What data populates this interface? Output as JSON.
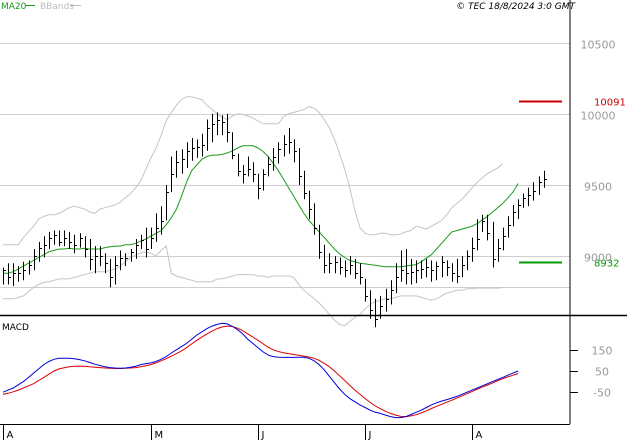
{
  "header": {
    "legend": [
      {
        "label": "MA20",
        "color": "#1a9a1a"
      },
      {
        "label": "BBands",
        "color": "#bbbbbb"
      }
    ],
    "copyright": "© TEC 18/8/2024 3:0 GMT"
  },
  "chart_data": [
    {
      "type": "line",
      "panel": "price",
      "ylim": [
        8600,
        10800
      ],
      "y_ticks": [
        10500,
        10000,
        9500,
        9000
      ],
      "y_tick_labels": [
        "10500",
        "10000",
        "9500",
        "9000"
      ],
      "x_labels": [
        "A",
        "M",
        "J",
        "J",
        "A"
      ],
      "x_label_bar_index": [
        0,
        29,
        50,
        71,
        92
      ],
      "grid": true,
      "markers": [
        {
          "label": "10091",
          "value": 10091,
          "color": "#cc0000"
        },
        {
          "label": "8932",
          "value": 8960,
          "color": "#009900"
        }
      ],
      "series": [
        {
          "name": "MA20",
          "color": "#1a9a1a",
          "values": [
            8880,
            8880,
            8890,
            8910,
            8930,
            8950,
            8970,
            8990,
            9010,
            9030,
            9040,
            9050,
            9050,
            9055,
            9050,
            9050,
            9055,
            9050,
            9050,
            9050,
            9060,
            9065,
            9070,
            9070,
            9080,
            9080,
            9090,
            9105,
            9120,
            9140,
            9160,
            9180,
            9220,
            9270,
            9330,
            9420,
            9520,
            9600,
            9640,
            9680,
            9700,
            9710,
            9710,
            9715,
            9725,
            9740,
            9760,
            9775,
            9775,
            9775,
            9760,
            9735,
            9700,
            9650,
            9600,
            9540,
            9480,
            9420,
            9360,
            9300,
            9250,
            9210,
            9170,
            9130,
            9090,
            9050,
            9015,
            8990,
            8970,
            8960,
            8950,
            8945,
            8940,
            8935,
            8930,
            8925,
            8925,
            8925,
            8925,
            8930,
            8935,
            8940,
            8960,
            8985,
            9010,
            9050,
            9090,
            9130,
            9170,
            9180,
            9190,
            9200,
            9210,
            9230,
            9255,
            9280,
            9310,
            9340,
            9370,
            9410,
            9450,
            9510
          ]
        },
        {
          "name": "BBands",
          "color": "#c4c4c4",
          "values": [
            9080,
            9080,
            9080,
            9080,
            9130,
            9170,
            9210,
            9260,
            9280,
            9290,
            9290,
            9300,
            9320,
            9340,
            9350,
            9340,
            9330,
            9310,
            9300,
            9330,
            9340,
            9350,
            9360,
            9380,
            9410,
            9440,
            9480,
            9530,
            9610,
            9690,
            9760,
            9850,
            9950,
            10010,
            10060,
            10100,
            10120,
            10120,
            10110,
            10100,
            10060,
            10030,
            10000,
            9975,
            9960,
            9985,
            10000,
            9995,
            9985,
            9970,
            9950,
            9930,
            9930,
            9930,
            9930,
            9980,
            10000,
            10010,
            10020,
            10030,
            10050,
            10040,
            10010,
            9960,
            9900,
            9820,
            9720,
            9610,
            9480,
            9320,
            9200,
            9160,
            9150,
            9150,
            9160,
            9160,
            9150,
            9150,
            9155,
            9170,
            9180,
            9210,
            9200,
            9190,
            9210,
            9230,
            9250,
            9290,
            9340,
            9370,
            9400,
            9440,
            9480,
            9520,
            9550,
            9580,
            9600,
            9620,
            9650
          ]
        },
        {
          "name": "BBands",
          "color": "#c4c4c4",
          "values": [
            8700,
            8700,
            8700,
            8710,
            8720,
            8750,
            8780,
            8800,
            8815,
            8820,
            8830,
            8840,
            8840,
            8840,
            8850,
            8860,
            8870,
            8880,
            8890,
            8890,
            8890,
            8900,
            8910,
            8930,
            8960,
            8990,
            9010,
            9020,
            9030,
            9020,
            9000,
            9040,
            9070,
            8880,
            8860,
            8850,
            8840,
            8830,
            8820,
            8820,
            8820,
            8820,
            8840,
            8840,
            8850,
            8860,
            8870,
            8870,
            8870,
            8870,
            8860,
            8860,
            8850,
            8860,
            8860,
            8860,
            8860,
            8850,
            8800,
            8760,
            8730,
            8700,
            8670,
            8630,
            8590,
            8550,
            8520,
            8510,
            8540,
            8570,
            8590,
            8630,
            8660,
            8680,
            8690,
            8700,
            8700,
            8710,
            8720,
            8720,
            8720,
            8720,
            8710,
            8700,
            8690,
            8700,
            8720,
            8740,
            8750,
            8760,
            8760,
            8770,
            8770,
            8775,
            8775,
            8775,
            8775,
            8775,
            8780
          ]
        }
      ],
      "bars": [
        {
          "h": 8920,
          "l": 8800,
          "c": 8900
        },
        {
          "h": 8950,
          "l": 8800,
          "c": 8850
        },
        {
          "h": 8950,
          "l": 8790,
          "c": 8880
        },
        {
          "h": 8930,
          "l": 8820,
          "c": 8880
        },
        {
          "h": 8960,
          "l": 8830,
          "c": 8900
        },
        {
          "h": 8970,
          "l": 8870,
          "c": 8940
        },
        {
          "h": 9050,
          "l": 8900,
          "c": 9000
        },
        {
          "h": 9100,
          "l": 8960,
          "c": 9060
        },
        {
          "h": 9140,
          "l": 8990,
          "c": 9080
        },
        {
          "h": 9170,
          "l": 9050,
          "c": 9130
        },
        {
          "h": 9180,
          "l": 9080,
          "c": 9150
        },
        {
          "h": 9180,
          "l": 9070,
          "c": 9100
        },
        {
          "h": 9180,
          "l": 9070,
          "c": 9130
        },
        {
          "h": 9170,
          "l": 9050,
          "c": 9100
        },
        {
          "h": 9150,
          "l": 9020,
          "c": 9080
        },
        {
          "h": 9160,
          "l": 9060,
          "c": 9130
        },
        {
          "h": 9140,
          "l": 8990,
          "c": 9050
        },
        {
          "h": 9120,
          "l": 8900,
          "c": 8980
        },
        {
          "h": 9070,
          "l": 8880,
          "c": 9000
        },
        {
          "h": 9070,
          "l": 8930,
          "c": 9000
        },
        {
          "h": 9020,
          "l": 8880,
          "c": 8950
        },
        {
          "h": 8980,
          "l": 8780,
          "c": 8850
        },
        {
          "h": 9000,
          "l": 8800,
          "c": 8940
        },
        {
          "h": 9040,
          "l": 8900,
          "c": 8990
        },
        {
          "h": 9020,
          "l": 8930,
          "c": 8990
        },
        {
          "h": 9050,
          "l": 8960,
          "c": 9030
        },
        {
          "h": 9120,
          "l": 8980,
          "c": 9080
        },
        {
          "h": 9150,
          "l": 9050,
          "c": 9110
        },
        {
          "h": 9200,
          "l": 8990,
          "c": 9050
        },
        {
          "h": 9200,
          "l": 9050,
          "c": 9130
        },
        {
          "h": 9300,
          "l": 9100,
          "c": 9200
        },
        {
          "h": 9350,
          "l": 9150,
          "c": 9250
        },
        {
          "h": 9500,
          "l": 9250,
          "c": 9450
        },
        {
          "h": 9700,
          "l": 9450,
          "c": 9580
        },
        {
          "h": 9740,
          "l": 9550,
          "c": 9660
        },
        {
          "h": 9750,
          "l": 9580,
          "c": 9680
        },
        {
          "h": 9800,
          "l": 9620,
          "c": 9740
        },
        {
          "h": 9830,
          "l": 9670,
          "c": 9760
        },
        {
          "h": 9820,
          "l": 9690,
          "c": 9770
        },
        {
          "h": 9860,
          "l": 9700,
          "c": 9780
        },
        {
          "h": 9960,
          "l": 9740,
          "c": 9900
        },
        {
          "h": 10000,
          "l": 9800,
          "c": 9930
        },
        {
          "h": 10010,
          "l": 9850,
          "c": 9960
        },
        {
          "h": 9990,
          "l": 9850,
          "c": 9940
        },
        {
          "h": 10000,
          "l": 9800,
          "c": 9870
        },
        {
          "h": 9870,
          "l": 9680,
          "c": 9710
        },
        {
          "h": 9720,
          "l": 9560,
          "c": 9600
        },
        {
          "h": 9640,
          "l": 9510,
          "c": 9580
        },
        {
          "h": 9700,
          "l": 9560,
          "c": 9610
        },
        {
          "h": 9660,
          "l": 9520,
          "c": 9580
        },
        {
          "h": 9580,
          "l": 9400,
          "c": 9480
        },
        {
          "h": 9610,
          "l": 9460,
          "c": 9580
        },
        {
          "h": 9700,
          "l": 9560,
          "c": 9650
        },
        {
          "h": 9760,
          "l": 9600,
          "c": 9700
        },
        {
          "h": 9800,
          "l": 9650,
          "c": 9750
        },
        {
          "h": 9850,
          "l": 9700,
          "c": 9790
        },
        {
          "h": 9900,
          "l": 9720,
          "c": 9800
        },
        {
          "h": 9820,
          "l": 9660,
          "c": 9740
        },
        {
          "h": 9760,
          "l": 9500,
          "c": 9560
        },
        {
          "h": 9600,
          "l": 9400,
          "c": 9440
        },
        {
          "h": 9460,
          "l": 9260,
          "c": 9330
        },
        {
          "h": 9370,
          "l": 9150,
          "c": 9200
        },
        {
          "h": 9220,
          "l": 8980,
          "c": 9030
        },
        {
          "h": 9080,
          "l": 8880,
          "c": 8940
        },
        {
          "h": 9020,
          "l": 8880,
          "c": 8950
        },
        {
          "h": 9000,
          "l": 8880,
          "c": 8960
        },
        {
          "h": 8990,
          "l": 8870,
          "c": 8920
        },
        {
          "h": 8970,
          "l": 8850,
          "c": 8900
        },
        {
          "h": 9000,
          "l": 8870,
          "c": 8940
        },
        {
          "h": 8980,
          "l": 8840,
          "c": 8880
        },
        {
          "h": 8950,
          "l": 8800,
          "c": 8850
        },
        {
          "h": 8840,
          "l": 8680,
          "c": 8720
        },
        {
          "h": 8760,
          "l": 8560,
          "c": 8620
        },
        {
          "h": 8700,
          "l": 8500,
          "c": 8560
        },
        {
          "h": 8720,
          "l": 8560,
          "c": 8650
        },
        {
          "h": 8770,
          "l": 8610,
          "c": 8700
        },
        {
          "h": 8830,
          "l": 8660,
          "c": 8760
        },
        {
          "h": 8950,
          "l": 8740,
          "c": 8850
        },
        {
          "h": 9040,
          "l": 8820,
          "c": 8900
        },
        {
          "h": 9050,
          "l": 8800,
          "c": 8880
        },
        {
          "h": 8980,
          "l": 8800,
          "c": 8890
        },
        {
          "h": 8970,
          "l": 8810,
          "c": 8900
        },
        {
          "h": 8970,
          "l": 8840,
          "c": 8910
        },
        {
          "h": 8980,
          "l": 8850,
          "c": 8920
        },
        {
          "h": 8970,
          "l": 8820,
          "c": 8900
        },
        {
          "h": 8960,
          "l": 8830,
          "c": 8930
        },
        {
          "h": 9000,
          "l": 8850,
          "c": 8960
        },
        {
          "h": 8970,
          "l": 8860,
          "c": 8920
        },
        {
          "h": 8950,
          "l": 8820,
          "c": 8880
        },
        {
          "h": 8980,
          "l": 8810,
          "c": 8860
        },
        {
          "h": 9000,
          "l": 8850,
          "c": 8940
        },
        {
          "h": 9040,
          "l": 8900,
          "c": 9000
        },
        {
          "h": 9130,
          "l": 8960,
          "c": 9060
        },
        {
          "h": 9260,
          "l": 9040,
          "c": 9120
        },
        {
          "h": 9290,
          "l": 9170,
          "c": 9250
        },
        {
          "h": 9290,
          "l": 9110,
          "c": 9160
        },
        {
          "h": 9240,
          "l": 8920,
          "c": 8980
        },
        {
          "h": 9120,
          "l": 8960,
          "c": 9060
        },
        {
          "h": 9200,
          "l": 9040,
          "c": 9140
        },
        {
          "h": 9280,
          "l": 9130,
          "c": 9220
        },
        {
          "h": 9360,
          "l": 9210,
          "c": 9310
        },
        {
          "h": 9400,
          "l": 9260,
          "c": 9360
        },
        {
          "h": 9440,
          "l": 9340,
          "c": 9410
        },
        {
          "h": 9480,
          "l": 9350,
          "c": 9430
        },
        {
          "h": 9520,
          "l": 9390,
          "c": 9460
        },
        {
          "h": 9560,
          "l": 9430,
          "c": 9520
        },
        {
          "h": 9600,
          "l": 9480,
          "c": 9540
        }
      ]
    },
    {
      "type": "line",
      "panel": "macd",
      "title": "MACD",
      "ylim": [
        -200,
        300
      ],
      "y_ticks": [
        150,
        50,
        -50
      ],
      "y_tick_labels": [
        "150",
        "50",
        "-50"
      ],
      "series": [
        {
          "name": "MACD",
          "color": "#0000dd",
          "values": [
            -50,
            -40,
            -30,
            -15,
            0,
            20,
            40,
            60,
            80,
            95,
            105,
            110,
            110,
            110,
            108,
            104,
            98,
            90,
            82,
            76,
            70,
            66,
            64,
            63,
            64,
            68,
            72,
            80,
            85,
            88,
            95,
            105,
            118,
            135,
            150,
            165,
            180,
            200,
            220,
            235,
            250,
            262,
            270,
            275,
            272,
            260,
            245,
            225,
            200,
            180,
            160,
            140,
            125,
            118,
            115,
            114,
            114,
            114,
            115,
            115,
            110,
            98,
            80,
            55,
            25,
            -5,
            -35,
            -60,
            -80,
            -95,
            -110,
            -122,
            -135,
            -145,
            -150,
            -158,
            -165,
            -170,
            -170,
            -165,
            -155,
            -145,
            -135,
            -122,
            -110,
            -100,
            -92,
            -85,
            -78,
            -70,
            -60,
            -50,
            -40,
            -30,
            -20,
            -10,
            0,
            10,
            20,
            30,
            40,
            50
          ]
        },
        {
          "name": "Signal",
          "color": "#dd0000",
          "values": [
            -60,
            -55,
            -48,
            -40,
            -30,
            -20,
            -10,
            5,
            20,
            35,
            50,
            60,
            65,
            70,
            72,
            73,
            72,
            70,
            68,
            66,
            64,
            63,
            62,
            62,
            63,
            64,
            66,
            70,
            75,
            80,
            88,
            98,
            108,
            120,
            132,
            145,
            160,
            178,
            195,
            210,
            225,
            238,
            250,
            258,
            262,
            260,
            252,
            240,
            225,
            210,
            195,
            178,
            162,
            150,
            142,
            136,
            132,
            128,
            124,
            120,
            116,
            110,
            100,
            86,
            70,
            50,
            28,
            5,
            -18,
            -40,
            -60,
            -80,
            -98,
            -115,
            -128,
            -140,
            -150,
            -158,
            -164,
            -165,
            -162,
            -156,
            -148,
            -138,
            -127,
            -117,
            -107,
            -97,
            -88,
            -78,
            -67,
            -57,
            -46,
            -36,
            -26,
            -16,
            -6,
            4,
            14,
            22,
            30,
            38
          ]
        }
      ]
    }
  ]
}
